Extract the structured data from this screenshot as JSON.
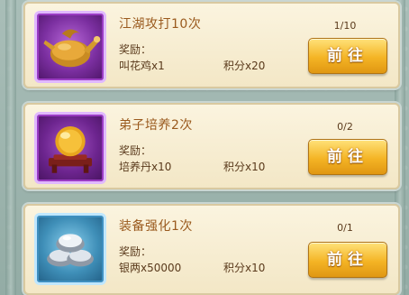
{
  "tasks": [
    {
      "title": "江湖攻打10次",
      "progress": "1/10",
      "reward_label": "奖励：",
      "reward_item": "叫花鸡x1",
      "reward_points": "积分x20",
      "button": "前往",
      "icon": "roast-chicken-icon",
      "frame_color": "#7b2fa0"
    },
    {
      "title": "弟子培养2次",
      "progress": "0/2",
      "reward_label": "奖励：",
      "reward_item": "培养丹x10",
      "reward_points": "积分x10",
      "button": "前往",
      "icon": "golden-pill-icon",
      "frame_color": "#6d258f"
    },
    {
      "title": "装备强化1次",
      "progress": "0/1",
      "reward_label": "奖励：",
      "reward_item": "银两x50000",
      "reward_points": "积分x10",
      "button": "前往",
      "icon": "silver-ingot-icon",
      "frame_color": "#3f8fb8"
    }
  ],
  "colors": {
    "title": "#9a5a1e",
    "text": "#5a3a1c",
    "button": "#f4b425",
    "card": "#fbf4df"
  }
}
